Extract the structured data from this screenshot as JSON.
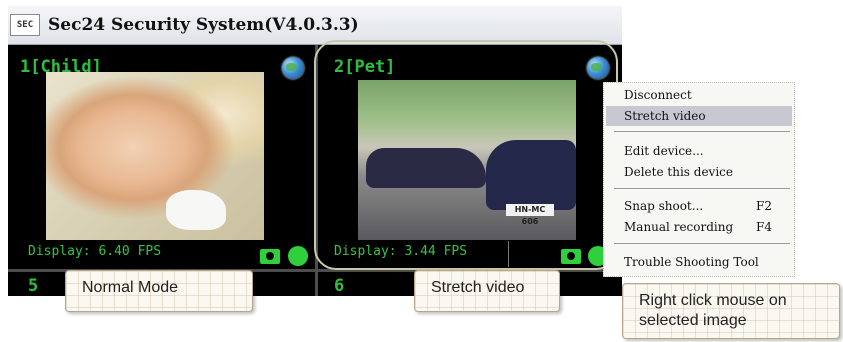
{
  "window": {
    "title": "Sec24 Security System(V4.0.3.3)",
    "logo_text": "SEC"
  },
  "cells": [
    {
      "label": "1[Child]",
      "fps": "Display: 6.40 FPS"
    },
    {
      "label": "2[Pet]",
      "fps": "Display: 3.44 FPS",
      "plate_text": "HN-MC 606"
    },
    {
      "label": "5"
    },
    {
      "label": "6"
    }
  ],
  "context_menu": {
    "items": [
      {
        "label": "Disconnect"
      },
      {
        "label": "Stretch video",
        "highlighted": true
      },
      {
        "label": "Edit device..."
      },
      {
        "label": "Delete this device"
      },
      {
        "label": "Snap shoot...",
        "shortcut": "F2"
      },
      {
        "label": "Manual recording",
        "shortcut": "F4"
      },
      {
        "label": "Trouble Shooting Tool"
      }
    ]
  },
  "callouts": {
    "normal_mode": "Normal Mode",
    "stretch_video": "Stretch video",
    "right_click_line1": "Right click mouse on",
    "right_click_line2": "selected image"
  },
  "icons": [
    "globe-icon",
    "snapshot-camera-icon",
    "record-dot-icon"
  ],
  "colors": {
    "accent_green": "#2fbf3e",
    "menu_highlight": "#c7c8d2",
    "callout_bg": "#fbf8f1"
  }
}
